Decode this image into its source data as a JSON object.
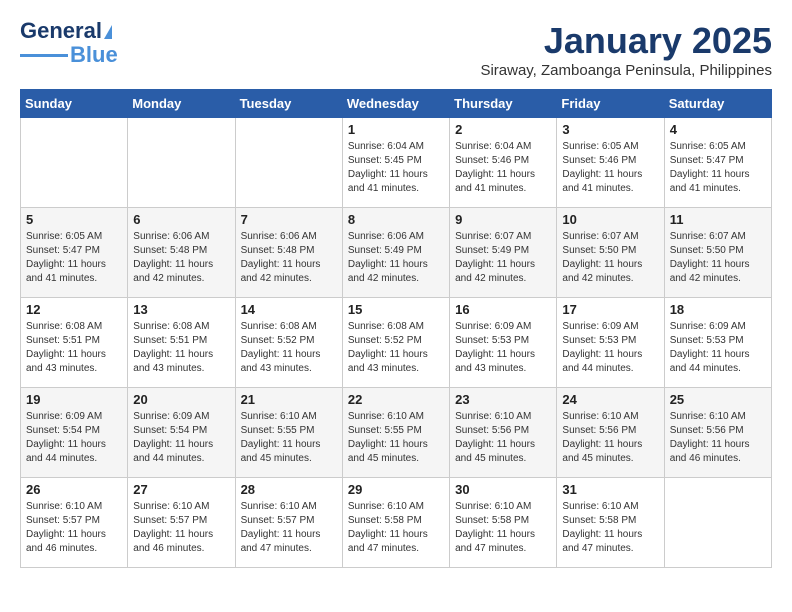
{
  "logo": {
    "line1": "General",
    "line2": "Blue"
  },
  "title": "January 2025",
  "subtitle": "Siraway, Zamboanga Peninsula, Philippines",
  "days_header": [
    "Sunday",
    "Monday",
    "Tuesday",
    "Wednesday",
    "Thursday",
    "Friday",
    "Saturday"
  ],
  "weeks": [
    [
      {
        "day": "",
        "info": ""
      },
      {
        "day": "",
        "info": ""
      },
      {
        "day": "",
        "info": ""
      },
      {
        "day": "1",
        "info": "Sunrise: 6:04 AM\nSunset: 5:45 PM\nDaylight: 11 hours\nand 41 minutes."
      },
      {
        "day": "2",
        "info": "Sunrise: 6:04 AM\nSunset: 5:46 PM\nDaylight: 11 hours\nand 41 minutes."
      },
      {
        "day": "3",
        "info": "Sunrise: 6:05 AM\nSunset: 5:46 PM\nDaylight: 11 hours\nand 41 minutes."
      },
      {
        "day": "4",
        "info": "Sunrise: 6:05 AM\nSunset: 5:47 PM\nDaylight: 11 hours\nand 41 minutes."
      }
    ],
    [
      {
        "day": "5",
        "info": "Sunrise: 6:05 AM\nSunset: 5:47 PM\nDaylight: 11 hours\nand 41 minutes."
      },
      {
        "day": "6",
        "info": "Sunrise: 6:06 AM\nSunset: 5:48 PM\nDaylight: 11 hours\nand 42 minutes."
      },
      {
        "day": "7",
        "info": "Sunrise: 6:06 AM\nSunset: 5:48 PM\nDaylight: 11 hours\nand 42 minutes."
      },
      {
        "day": "8",
        "info": "Sunrise: 6:06 AM\nSunset: 5:49 PM\nDaylight: 11 hours\nand 42 minutes."
      },
      {
        "day": "9",
        "info": "Sunrise: 6:07 AM\nSunset: 5:49 PM\nDaylight: 11 hours\nand 42 minutes."
      },
      {
        "day": "10",
        "info": "Sunrise: 6:07 AM\nSunset: 5:50 PM\nDaylight: 11 hours\nand 42 minutes."
      },
      {
        "day": "11",
        "info": "Sunrise: 6:07 AM\nSunset: 5:50 PM\nDaylight: 11 hours\nand 42 minutes."
      }
    ],
    [
      {
        "day": "12",
        "info": "Sunrise: 6:08 AM\nSunset: 5:51 PM\nDaylight: 11 hours\nand 43 minutes."
      },
      {
        "day": "13",
        "info": "Sunrise: 6:08 AM\nSunset: 5:51 PM\nDaylight: 11 hours\nand 43 minutes."
      },
      {
        "day": "14",
        "info": "Sunrise: 6:08 AM\nSunset: 5:52 PM\nDaylight: 11 hours\nand 43 minutes."
      },
      {
        "day": "15",
        "info": "Sunrise: 6:08 AM\nSunset: 5:52 PM\nDaylight: 11 hours\nand 43 minutes."
      },
      {
        "day": "16",
        "info": "Sunrise: 6:09 AM\nSunset: 5:53 PM\nDaylight: 11 hours\nand 43 minutes."
      },
      {
        "day": "17",
        "info": "Sunrise: 6:09 AM\nSunset: 5:53 PM\nDaylight: 11 hours\nand 44 minutes."
      },
      {
        "day": "18",
        "info": "Sunrise: 6:09 AM\nSunset: 5:53 PM\nDaylight: 11 hours\nand 44 minutes."
      }
    ],
    [
      {
        "day": "19",
        "info": "Sunrise: 6:09 AM\nSunset: 5:54 PM\nDaylight: 11 hours\nand 44 minutes."
      },
      {
        "day": "20",
        "info": "Sunrise: 6:09 AM\nSunset: 5:54 PM\nDaylight: 11 hours\nand 44 minutes."
      },
      {
        "day": "21",
        "info": "Sunrise: 6:10 AM\nSunset: 5:55 PM\nDaylight: 11 hours\nand 45 minutes."
      },
      {
        "day": "22",
        "info": "Sunrise: 6:10 AM\nSunset: 5:55 PM\nDaylight: 11 hours\nand 45 minutes."
      },
      {
        "day": "23",
        "info": "Sunrise: 6:10 AM\nSunset: 5:56 PM\nDaylight: 11 hours\nand 45 minutes."
      },
      {
        "day": "24",
        "info": "Sunrise: 6:10 AM\nSunset: 5:56 PM\nDaylight: 11 hours\nand 45 minutes."
      },
      {
        "day": "25",
        "info": "Sunrise: 6:10 AM\nSunset: 5:56 PM\nDaylight: 11 hours\nand 46 minutes."
      }
    ],
    [
      {
        "day": "26",
        "info": "Sunrise: 6:10 AM\nSunset: 5:57 PM\nDaylight: 11 hours\nand 46 minutes."
      },
      {
        "day": "27",
        "info": "Sunrise: 6:10 AM\nSunset: 5:57 PM\nDaylight: 11 hours\nand 46 minutes."
      },
      {
        "day": "28",
        "info": "Sunrise: 6:10 AM\nSunset: 5:57 PM\nDaylight: 11 hours\nand 47 minutes."
      },
      {
        "day": "29",
        "info": "Sunrise: 6:10 AM\nSunset: 5:58 PM\nDaylight: 11 hours\nand 47 minutes."
      },
      {
        "day": "30",
        "info": "Sunrise: 6:10 AM\nSunset: 5:58 PM\nDaylight: 11 hours\nand 47 minutes."
      },
      {
        "day": "31",
        "info": "Sunrise: 6:10 AM\nSunset: 5:58 PM\nDaylight: 11 hours\nand 47 minutes."
      },
      {
        "day": "",
        "info": ""
      }
    ]
  ]
}
